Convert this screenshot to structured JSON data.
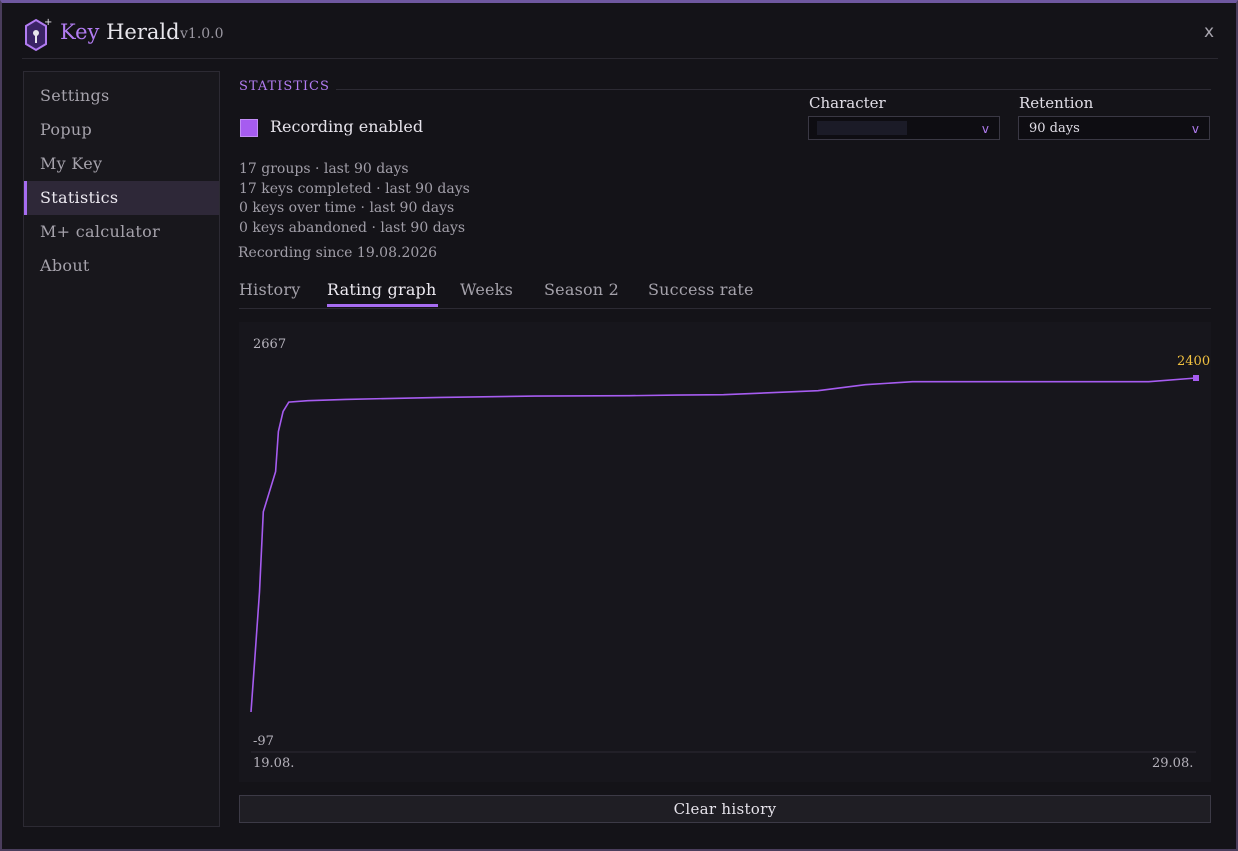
{
  "app": {
    "title_key": "Key",
    "title_rest": "Herald",
    "version": "v1.0.0",
    "close_label": "x"
  },
  "sidebar": {
    "items": [
      {
        "label": "Settings"
      },
      {
        "label": "Popup"
      },
      {
        "label": "My Key"
      },
      {
        "label": "Statistics",
        "active": true
      },
      {
        "label": "M+ calculator"
      },
      {
        "label": "About"
      }
    ]
  },
  "statistics": {
    "section_title": "STATISTICS",
    "recording_label": "Recording enabled",
    "recording_enabled": true,
    "character": {
      "label": "Character",
      "value": ""
    },
    "retention": {
      "label": "Retention",
      "value": "90 days"
    },
    "summary": [
      "17 groups  ·  last 90 days",
      "17 keys completed  ·  last 90 days",
      "0 keys over time  ·  last 90 days",
      "0 keys abandoned  ·  last 90 days"
    ],
    "recording_since": "Recording since  19.08.2026",
    "tabs": [
      "History",
      "Rating graph",
      "Weeks",
      "Season 2",
      "Success rate"
    ],
    "active_tab": "Rating graph",
    "clear_button": "Clear history"
  },
  "chart_data": {
    "type": "line",
    "y_max_label": "2667",
    "y_min_label": "-97",
    "x_start_label": "19.08.",
    "x_end_label": "29.08.",
    "last_value_label": "2400",
    "ylim": [
      -97,
      2667
    ],
    "x": [
      0,
      0.04,
      0.09,
      0.13,
      0.26,
      0.29,
      0.34,
      0.4,
      0.6,
      1.0,
      2.0,
      3.0,
      4.0,
      4.5,
      5.0,
      5.5,
      6.0,
      6.5,
      7.0,
      7.5,
      8.0,
      8.5,
      9.0,
      9.5,
      10.0
    ],
    "y": [
      -97,
      300,
      800,
      1400,
      1700,
      2000,
      2150,
      2220,
      2230,
      2240,
      2255,
      2265,
      2268,
      2272,
      2275,
      2290,
      2305,
      2350,
      2372,
      2372,
      2372,
      2372,
      2372,
      2372,
      2400
    ],
    "colors": {
      "line": "#a65cf0",
      "last_value": "#f0c040"
    }
  }
}
